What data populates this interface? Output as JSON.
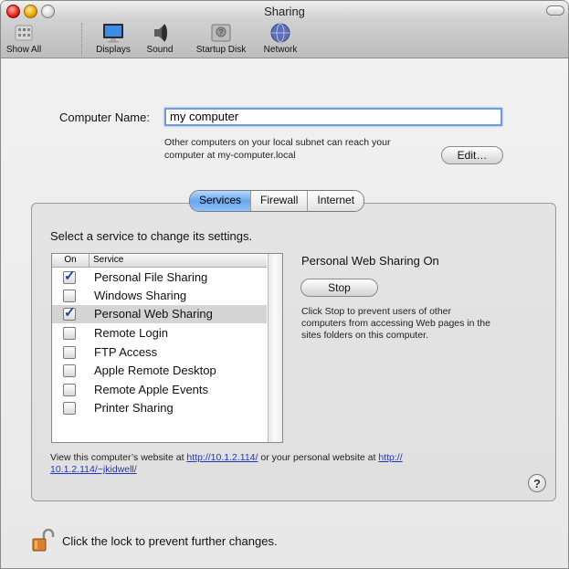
{
  "window": {
    "title": "Sharing"
  },
  "toolbar": {
    "items": [
      {
        "label": "Show All",
        "icon": "show-all-grid-icon"
      },
      {
        "label": "Displays",
        "icon": "display-icon"
      },
      {
        "label": "Sound",
        "icon": "speaker-icon"
      },
      {
        "label": "Startup Disk",
        "icon": "hard-disk-icon"
      },
      {
        "label": "Network",
        "icon": "globe-icon"
      }
    ]
  },
  "computer_name": {
    "label": "Computer Name:",
    "value": "my computer",
    "info_line1": "Other computers on your local subnet can reach your",
    "info_line2": "computer at my-computer.local",
    "edit_button": "Edit…"
  },
  "tabs": [
    {
      "label": "Services",
      "active": true
    },
    {
      "label": "Firewall",
      "active": false
    },
    {
      "label": "Internet",
      "active": false
    }
  ],
  "services": {
    "prompt": "Select a service to change its settings.",
    "col_on": "On",
    "col_service": "Service",
    "items": [
      {
        "label": "Personal File Sharing",
        "checked": true,
        "selected": false
      },
      {
        "label": "Windows Sharing",
        "checked": false,
        "selected": false
      },
      {
        "label": "Personal Web Sharing",
        "checked": true,
        "selected": true
      },
      {
        "label": "Remote Login",
        "checked": false,
        "selected": false
      },
      {
        "label": "FTP Access",
        "checked": false,
        "selected": false
      },
      {
        "label": "Apple Remote Desktop",
        "checked": false,
        "selected": false
      },
      {
        "label": "Remote Apple Events",
        "checked": false,
        "selected": false
      },
      {
        "label": "Printer Sharing",
        "checked": false,
        "selected": false
      }
    ]
  },
  "detail": {
    "status": "Personal Web Sharing On",
    "button": "Stop",
    "desc_line1": "Click Stop to prevent users of other",
    "desc_line2": "computers from accessing Web pages in the",
    "desc_line3": "sites folders on this computer."
  },
  "footer_info": {
    "text1": "View this computer’s website at ",
    "link1": "http://10.1.2.114/",
    "text2": " or your personal website at ",
    "link2a": "http://",
    "link2b": "10.1.2.114/~jkidwell/"
  },
  "help_label": "?",
  "lock": {
    "text": "Click the lock to prevent further changes.",
    "icon": "open-lock-icon"
  },
  "colors": {
    "accent": "#69a7ef",
    "link": "#1f36c4"
  }
}
